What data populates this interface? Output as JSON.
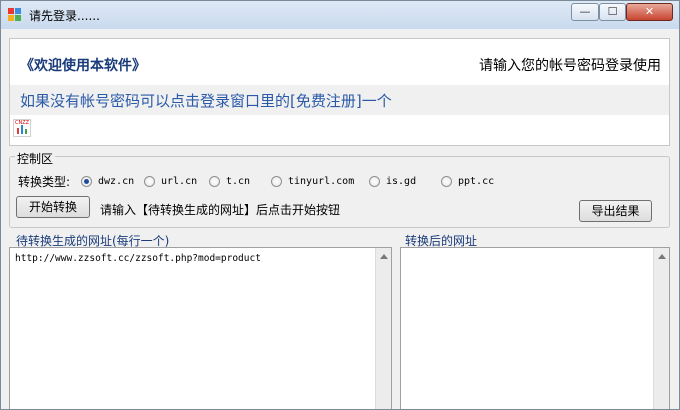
{
  "window": {
    "title": "请先登录......",
    "controls": {
      "minimize": "—",
      "maximize": "☐",
      "close": "✕"
    }
  },
  "banner": {
    "welcome": "《欢迎使用本软件》",
    "login_hint": "请输入您的帐号密码登录使用",
    "register_hint": "如果没有帐号密码可以点击登录窗口里的[免费注册]一个",
    "cnzz_logo": "CNZZ"
  },
  "control_area": {
    "group_label": "控制区",
    "type_label": "转换类型:",
    "options": [
      {
        "label": "dwz.cn",
        "checked": true
      },
      {
        "label": "url.cn",
        "checked": false
      },
      {
        "label": "t.cn",
        "checked": false
      },
      {
        "label": "tinyurl.com",
        "checked": false
      },
      {
        "label": "is.gd",
        "checked": false
      },
      {
        "label": "ppt.cc",
        "checked": false
      }
    ],
    "start_button": "开始转换",
    "instruction": "请输入【待转换生成的网址】后点击开始按钮",
    "export_button": "导出结果"
  },
  "input_panel": {
    "label": "待转换生成的网址(每行一个)",
    "value": "http://www.zzsoft.cc/zzsoft.php?mod=product"
  },
  "output_panel": {
    "label": "转换后的网址",
    "value": ""
  },
  "colors": {
    "accent": "#1a3b7a",
    "link": "#2a5aa8",
    "radio_selected": "#1e4b9e"
  }
}
